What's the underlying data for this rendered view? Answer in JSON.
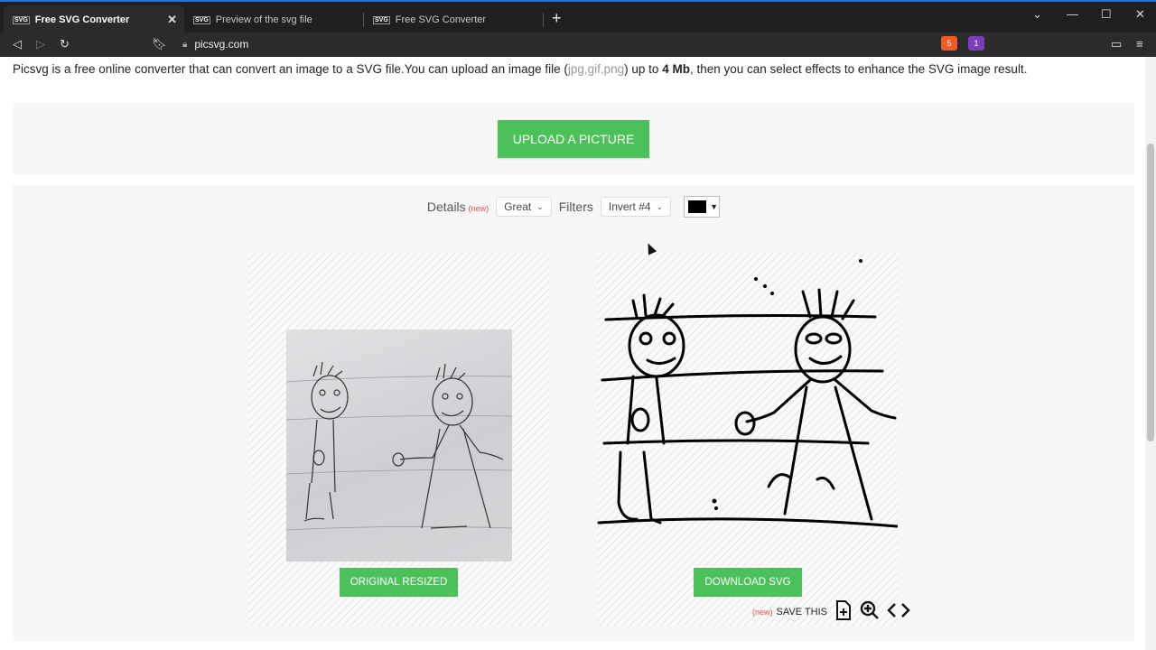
{
  "browser": {
    "tabs": [
      {
        "title": "Free SVG Converter",
        "favicon": "SVG"
      },
      {
        "title": "Preview of the svg file",
        "favicon": "SVG"
      },
      {
        "title": "Free SVG Converter",
        "favicon": "SVG"
      }
    ],
    "url": "picsvg.com",
    "brave_badge": "5",
    "alert_badge": "1"
  },
  "page": {
    "intro": {
      "text_a": "Picsvg is a free online converter that can convert an image to a SVG file.You can upload an image file (",
      "formats": "jpg,gif,png",
      "text_b": ") up to ",
      "size": "4 Mb",
      "text_c": ", then you can select effects to enhance the SVG image result."
    },
    "upload_label": "UPLOAD A PICTURE",
    "controls": {
      "details_label": "Details",
      "new_tag": "(new)",
      "details_value": "Great",
      "filters_label": "Filters",
      "filters_value": "Invert #4",
      "color": "#000000"
    },
    "original_label": "ORIGINAL RESIZED",
    "download_label": "DOWNLOAD SVG",
    "save": {
      "new_tag": "(new)",
      "label": "SAVE THIS"
    }
  },
  "colors": {
    "accent_green": "#4cc159",
    "new_red": "#d9534f"
  }
}
